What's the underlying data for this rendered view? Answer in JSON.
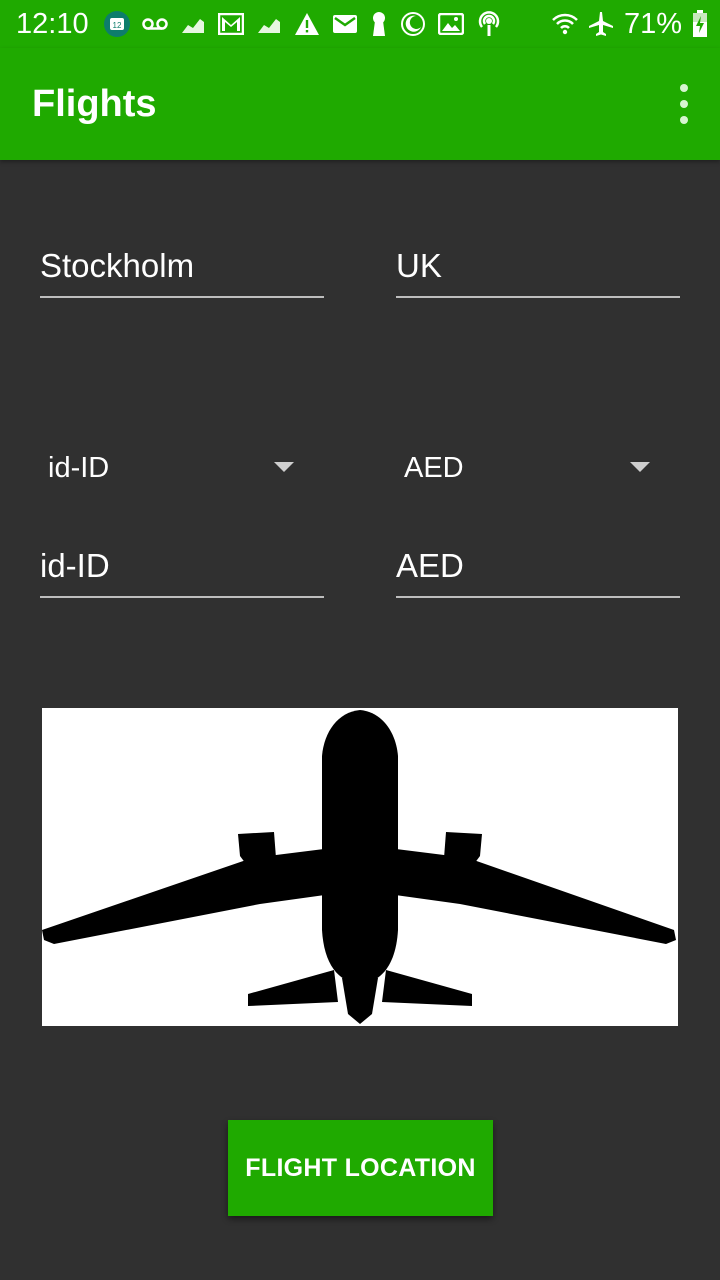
{
  "status_bar": {
    "time": "12:10",
    "battery_percent": "71%",
    "left_icons": [
      "calendar-icon",
      "voicemail-icon",
      "chart-icon",
      "gmail-icon",
      "chart-icon",
      "warning-icon",
      "email-icon",
      "keyhole-icon",
      "moon-icon",
      "photo-icon",
      "podcast-icon"
    ],
    "right_icons": [
      "wifi-icon",
      "airplane-mode-icon",
      "battery-charging-icon"
    ],
    "calendar_day": "12"
  },
  "app_bar": {
    "title": "Flights",
    "menu_icon": "more-vert-icon"
  },
  "form": {
    "origin_field": "Stockholm",
    "destination_field": "UK",
    "locale_spinner": "id-ID",
    "currency_spinner": "AED",
    "locale_field": "id-ID",
    "currency_field": "AED"
  },
  "image": {
    "icon": "airplane-silhouette-icon"
  },
  "button": {
    "label": "FLIGHT LOCATION"
  },
  "colors": {
    "primary": "#1faa00",
    "background": "#303030",
    "text": "#ffffff",
    "underline": "#bdbdbd"
  }
}
